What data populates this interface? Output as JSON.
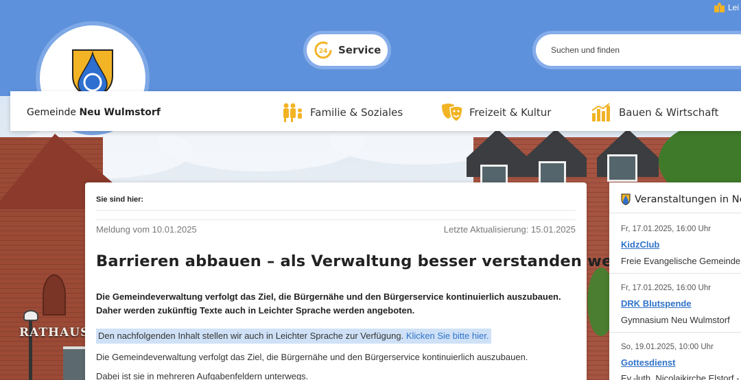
{
  "header": {
    "site_name_prefix": "Gemeinde",
    "site_name_bold": "Neu Wulmstorf",
    "service_label": "Service",
    "service_icon": "24h-icon",
    "search_placeholder": "Suchen und finden",
    "top_link_label": "Lei",
    "colors": {
      "header_blue": "#5e91db",
      "accent_yellow": "#f2b324",
      "link_blue": "#2f73c9"
    }
  },
  "nav": {
    "items": [
      {
        "label": "Familie & Soziales",
        "icon": "family-icon"
      },
      {
        "label": "Freizeit & Kultur",
        "icon": "theater-masks-icon"
      },
      {
        "label": "Bauen & Wirtschaft",
        "icon": "bar-chart-icon"
      }
    ]
  },
  "hero": {
    "building_sign": "RATHAUS"
  },
  "article": {
    "breadcrumb_label": "Sie sind hier:",
    "meta_left": "Meldung vom 10.01.2025",
    "meta_right": "Letzte Aktualisierung: 15.01.2025",
    "title": "Barrieren abbauen – als Verwaltung besser verstanden werden",
    "lead": "Die Gemeindeverwaltung verfolgt das Ziel, die Bürgernähe und den Bürgerservice kontinuierlich auszubauen. Daher werden zukünftig Texte auch in Leichter Sprache werden angeboten.",
    "easy_language_text": "Den nachfolgenden Inhalt stellen wir auch in Leichter Sprache zur Verfügung.",
    "easy_language_link": "Klicken Sie bitte hier.",
    "paragraphs": [
      "Die Gemeindeverwaltung verfolgt das Ziel, die Bürgernähe und den Bürgerservice kontinuierlich auszubauen.",
      "Dabei ist sie in mehreren Aufgabenfeldern unterwegs."
    ]
  },
  "events": {
    "heading": "Veranstaltungen in Ne",
    "items": [
      {
        "date": "Fr, 17.01.2025, 16:00 Uhr",
        "title": "KidzClub",
        "place": "Freie Evangelische Gemeinde"
      },
      {
        "date": "Fr, 17.01.2025, 16:00 Uhr",
        "title": "DRK Blutspende",
        "place": "Gymnasium Neu Wulmstorf"
      },
      {
        "date": "So, 19.01.2025, 10:00 Uhr",
        "title": "Gottesdienst",
        "place": "Ev.-luth. Nicolaikirche Elstorf -"
      }
    ]
  }
}
